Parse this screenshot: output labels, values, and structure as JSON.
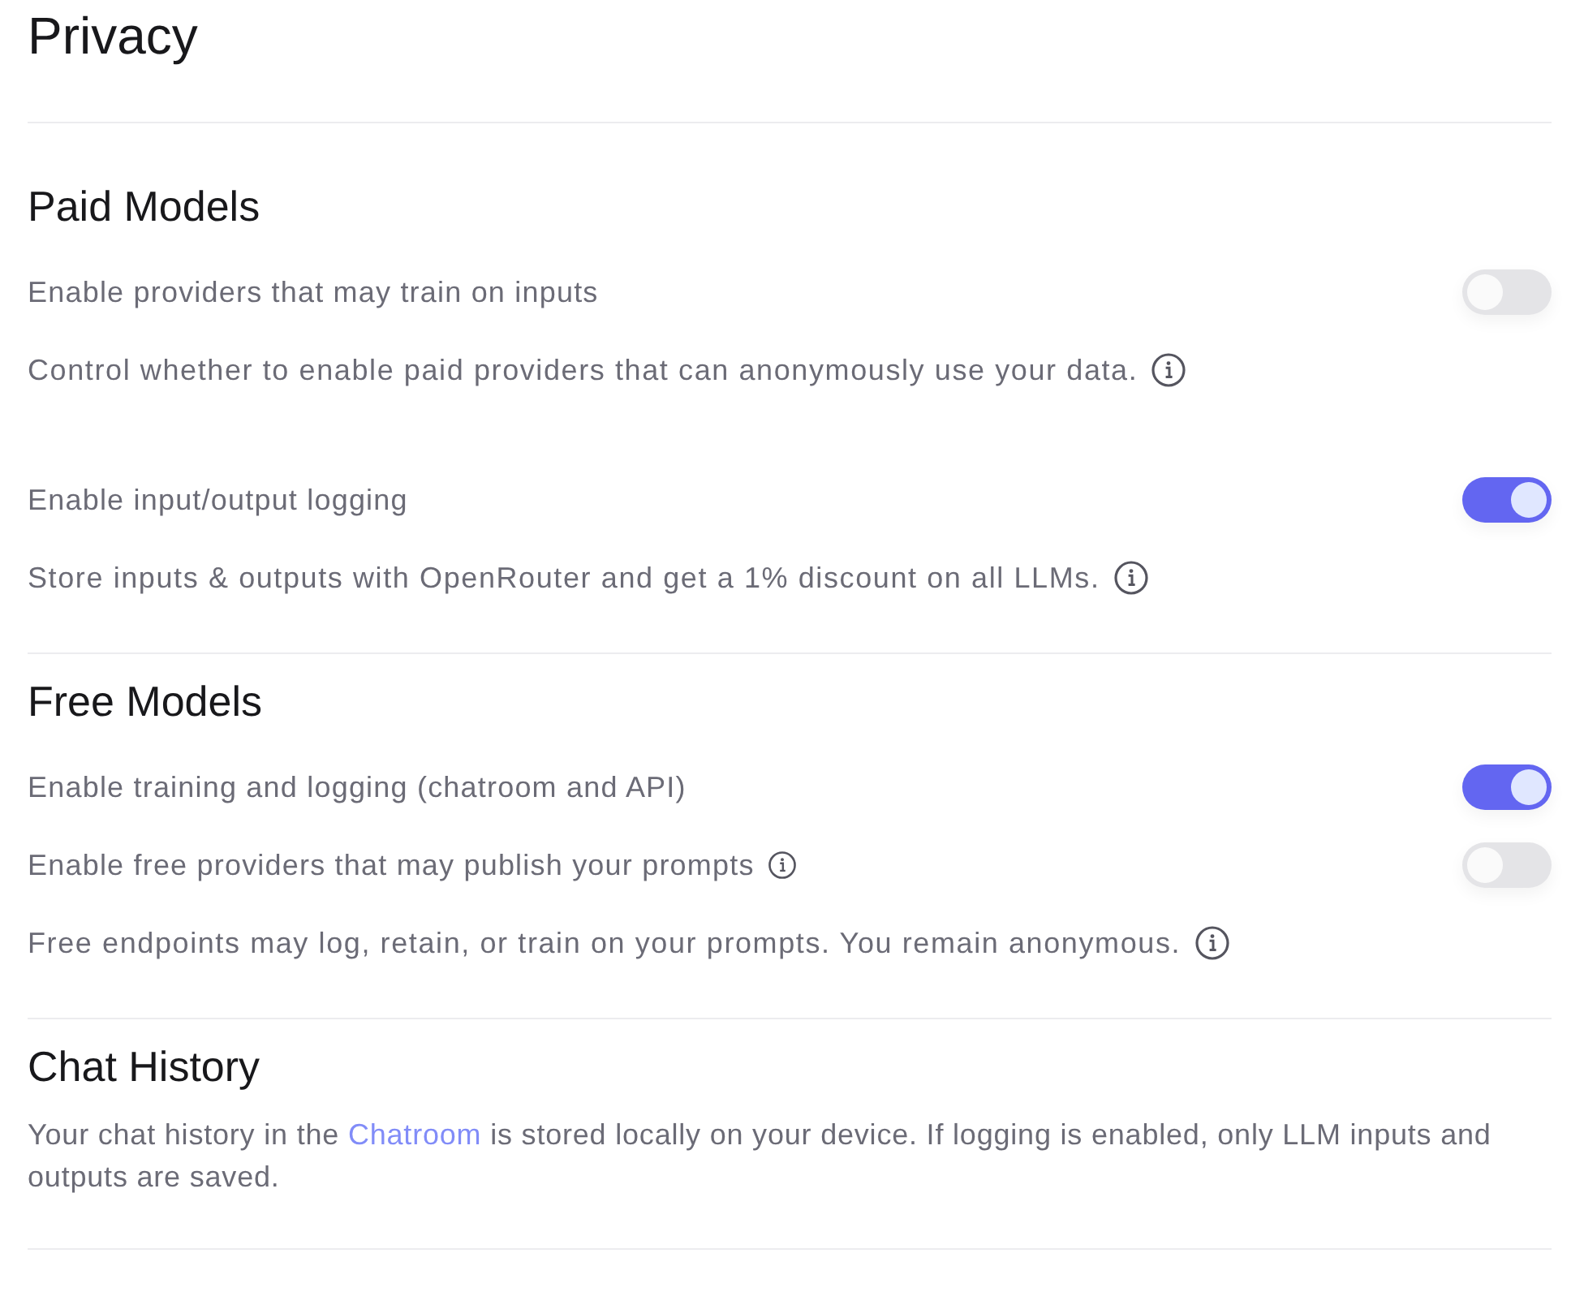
{
  "page": {
    "title": "Privacy"
  },
  "sections": [
    {
      "title": "Paid Models",
      "items": [
        {
          "kind": "toggle",
          "label": "Enable providers that may train on inputs",
          "on": false,
          "info": false
        },
        {
          "kind": "note",
          "text": "Control whether to enable paid providers that can anonymously use your data.",
          "info": true
        },
        {
          "kind": "toggle",
          "label": "Enable input/output logging",
          "on": true,
          "info": false
        },
        {
          "kind": "note",
          "text": "Store inputs & outputs with OpenRouter and get a 1% discount on all LLMs.",
          "info": true
        }
      ]
    },
    {
      "title": "Free Models",
      "items": [
        {
          "kind": "toggle",
          "label": "Enable training and logging (chatroom and API)",
          "on": true,
          "info": false
        },
        {
          "kind": "toggle",
          "label": "Enable free providers that may publish your prompts",
          "on": false,
          "info": true
        },
        {
          "kind": "note",
          "text": "Free endpoints may log, retain, or train on your prompts. You remain anonymous.",
          "info": true
        }
      ]
    },
    {
      "title": "Chat History",
      "items": [
        {
          "kind": "paragraph",
          "text_before": "Your chat history in the",
          "link": "Chatroom",
          "text_after": "is stored locally on your device. If logging is enabled, only LLM inputs and outputs are saved."
        }
      ]
    }
  ]
}
